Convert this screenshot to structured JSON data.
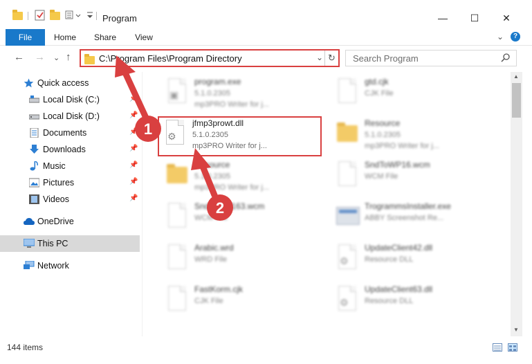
{
  "window": {
    "title": "Program",
    "minimize": "—",
    "maximize": "☐",
    "close": "✕"
  },
  "ribbon": {
    "tabs": [
      "File",
      "Home",
      "Share",
      "View"
    ],
    "collapse": "⌄",
    "help": "?"
  },
  "nav": {
    "back": "←",
    "forward": "→",
    "recent": "⌄",
    "up": "↑",
    "address": "C:\\Program Files\\Program Directory",
    "address_chevron": "⌄",
    "refresh": "↻",
    "search_placeholder": "Search Program",
    "search_icon": "⌕"
  },
  "sidebar": {
    "items": [
      {
        "label": "Quick access",
        "icon": "star-icon"
      },
      {
        "label": "Local Disk (C:)",
        "icon": "drive-icon",
        "pinned": true
      },
      {
        "label": "Local Disk (D:)",
        "icon": "drive-icon",
        "pinned": true
      },
      {
        "label": "Documents",
        "icon": "documents-icon",
        "pinned": true
      },
      {
        "label": "Downloads",
        "icon": "downloads-icon",
        "pinned": true
      },
      {
        "label": "Music",
        "icon": "music-icon",
        "pinned": true
      },
      {
        "label": "Pictures",
        "icon": "pictures-icon",
        "pinned": true
      },
      {
        "label": "Videos",
        "icon": "videos-icon",
        "pinned": true
      },
      {
        "label": "OneDrive",
        "icon": "cloud-icon"
      },
      {
        "label": "This PC",
        "icon": "computer-icon",
        "selected": true
      },
      {
        "label": "Network",
        "icon": "network-icon"
      }
    ],
    "pin_glyph": "📌"
  },
  "files": [
    {
      "name": "program.exe",
      "line1": "5.1.0.2305",
      "line2": "mp3PRO Writer for j...",
      "icon": "exe-icon"
    },
    {
      "name": "gtd.cjk",
      "line1": "CJK File",
      "line2": "",
      "icon": "document-icon"
    },
    {
      "name": "jfmp3prowt.dll",
      "line1": "5.1.0.2305",
      "line2": "mp3PRO Writer for j...",
      "icon": "dll-gear-icon"
    },
    {
      "name": "Resource",
      "line1": "5.1.0.2305",
      "line2": "mp3PRO Writer for j...",
      "icon": "folder-icon"
    },
    {
      "name": "Resource",
      "line1": "5.1.0.2305",
      "line2": "mp3PRO Writer for j...",
      "icon": "folder-icon"
    },
    {
      "name": "SndToWP16.wcm",
      "line1": "WCM File",
      "line2": "",
      "icon": "document-icon"
    },
    {
      "name": "SndToWP163.wcm",
      "line1": "WCM File",
      "line2": "",
      "icon": "document-icon"
    },
    {
      "name": "TrogrammsInstaller.exe",
      "line1": "ABBY Screenshot Re...",
      "line2": "",
      "icon": "installer-icon"
    },
    {
      "name": "Arabic.wrd",
      "line1": "WRD File",
      "line2": "",
      "icon": "document-icon"
    },
    {
      "name": "UpdateClient42.dll",
      "line1": "Resource DLL",
      "line2": "",
      "icon": "dll-gear-icon"
    },
    {
      "name": "FastKorm.cjk",
      "line1": "CJK File",
      "line2": "",
      "icon": "document-icon"
    },
    {
      "name": "UpdateClient63.dll",
      "line1": "Resource DLL",
      "line2": "",
      "icon": "dll-gear-icon"
    }
  ],
  "annotations": {
    "badge1": "1",
    "badge2": "2"
  },
  "status": {
    "item_count": "144 items"
  },
  "colors": {
    "accent": "#1979ca",
    "annotation_red": "#d94040",
    "folder_yellow": "#f2c24d"
  }
}
